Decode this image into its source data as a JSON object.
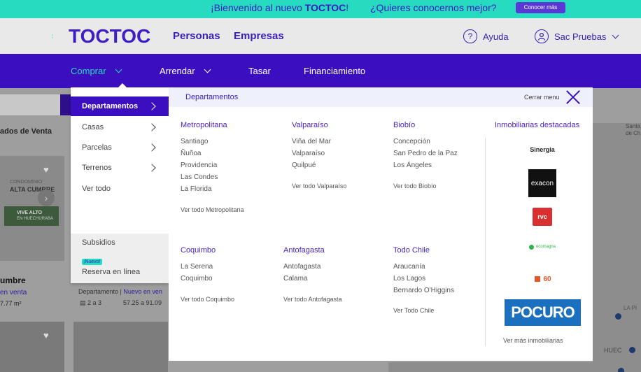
{
  "banner": {
    "welcome_prefix": "¡Bienvenido al nuevo ",
    "welcome_brand": "TOCTOC",
    "welcome_suffix": "!",
    "question": "¿Quieres conocernos mejor?",
    "cta_label": "Conocer más"
  },
  "header": {
    "logo_text": "TOCTOC",
    "nav": [
      "Personas",
      "Empresas"
    ],
    "help_label": "Ayuda",
    "user_label": "Sac Pruebas"
  },
  "purple_nav": {
    "items": [
      "Comprar",
      "Arrendar",
      "Tasar",
      "Financiamiento"
    ]
  },
  "left_menu": {
    "items": [
      "Departamentos",
      "Casas",
      "Parcelas",
      "Terrenos"
    ],
    "see_all": "Ver todo",
    "subsidios": "Subsidios",
    "new_badge": "¡Nuevo!",
    "reserva": "Reserva en línea"
  },
  "panel": {
    "title": "Departamentos",
    "close_label": "Cerrar menu",
    "regions": [
      {
        "name": "Metropolitana",
        "cities": [
          "Santiago",
          "Ñuñoa",
          "Providencia",
          "Las Condes",
          "La Florida"
        ],
        "see_all": "Ver todo Metropolitana"
      },
      {
        "name": "Valparaíso",
        "cities": [
          "Viña del Mar",
          "Valparaíso",
          "Quilpué"
        ],
        "see_all": "Ver todo Valparaíso"
      },
      {
        "name": "Biobío",
        "cities": [
          "Concepción",
          "San Pedro de la Paz",
          "Los Ángeles"
        ],
        "see_all": "Ver todo Biobío"
      },
      {
        "name": "Coquimbo",
        "cities": [
          "La Serena",
          "Coquimbo"
        ],
        "see_all": "Ver todo Coquimbo"
      },
      {
        "name": "Antofagasta",
        "cities": [
          "Antofagasta",
          "Calama"
        ],
        "see_all": "Ver todo Antofagasta"
      },
      {
        "name": "Todo Chile",
        "cities": [
          "Araucanía",
          "Los Lagos",
          "Bernardo O'Higgins"
        ],
        "see_all": "Ver Todo Chile"
      }
    ],
    "featured_title": "Inmobiliarias destacadas",
    "featured_brands": [
      "Sinergia",
      "exacon",
      "rvc",
      "ecomagna",
      "60",
      "POCURO"
    ],
    "featured_see_all": "Ver más inmobiliarias"
  },
  "background": {
    "results_label": "ados de Venta",
    "card_brand_line1": "CONDOMINIO",
    "card_brand_line2": "ALTA CUMBRE",
    "card_banner_line1": "VIVE ALTO",
    "card_banner_line2": "EN HUECHURABA",
    "card_title": "umbre",
    "card_sub": "en venta",
    "card_area": "7.77 m²",
    "card2_type": "Departamento | ",
    "card2_status": "Nuevo en ven",
    "card2_rooms": "2 a 3",
    "card2_area": "57.25 a 91.09",
    "map_labels": [
      "Santa",
      "de Ch",
      "LA PI",
      "HUEC"
    ]
  }
}
